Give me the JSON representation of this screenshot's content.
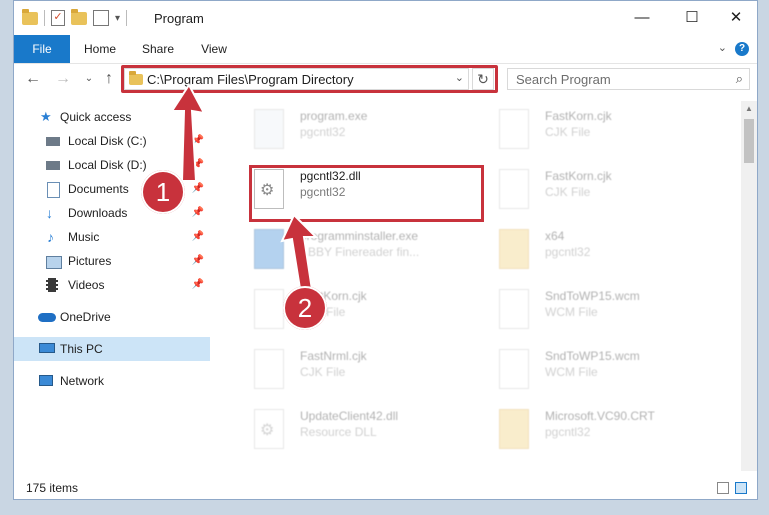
{
  "window": {
    "title": "Program"
  },
  "controls": {
    "minimize": "—",
    "maximize": "☐",
    "close": "✕"
  },
  "ribbon": {
    "tabs": [
      "File",
      "Home",
      "Share",
      "View"
    ],
    "help": "?"
  },
  "address": {
    "path": "C:\\Program Files\\Program Directory"
  },
  "search": {
    "placeholder": "Search Program"
  },
  "sidebar": {
    "items": [
      {
        "label": "Quick access"
      },
      {
        "label": "Local Disk (C:)"
      },
      {
        "label": "Local Disk (D:)"
      },
      {
        "label": "Documents"
      },
      {
        "label": "Downloads"
      },
      {
        "label": "Music"
      },
      {
        "label": "Pictures"
      },
      {
        "label": "Videos"
      },
      {
        "label": "OneDrive"
      },
      {
        "label": "This PC"
      },
      {
        "label": "Network"
      }
    ]
  },
  "files": [
    {
      "name": "program.exe",
      "sub": "pgcntl32"
    },
    {
      "name": "FastKorn.cjk",
      "sub": "CJK File"
    },
    {
      "name": "pgcntl32.dll",
      "sub": "pgcntl32"
    },
    {
      "name": "FastKorn.cjk",
      "sub": "CJK File"
    },
    {
      "name": "programminstaller.exe",
      "sub": "ABBY Finereader fin..."
    },
    {
      "name": "x64",
      "sub": "pgcntl32"
    },
    {
      "name": "FastKorn.cjk",
      "sub": "CJK File"
    },
    {
      "name": "SndToWP15.wcm",
      "sub": "WCM File"
    },
    {
      "name": "FastNrml.cjk",
      "sub": "CJK File"
    },
    {
      "name": "SndToWP15.wcm",
      "sub": "WCM File"
    },
    {
      "name": "UpdateClient42.dll",
      "sub": "Resource DLL"
    },
    {
      "name": "Microsoft.VC90.CRT",
      "sub": "pgcntl32"
    }
  ],
  "status": {
    "count": "175 items"
  },
  "annotations": {
    "step1": "1",
    "step2": "2"
  },
  "colors": {
    "highlight": "#c8323c",
    "accent": "#1979ca"
  }
}
